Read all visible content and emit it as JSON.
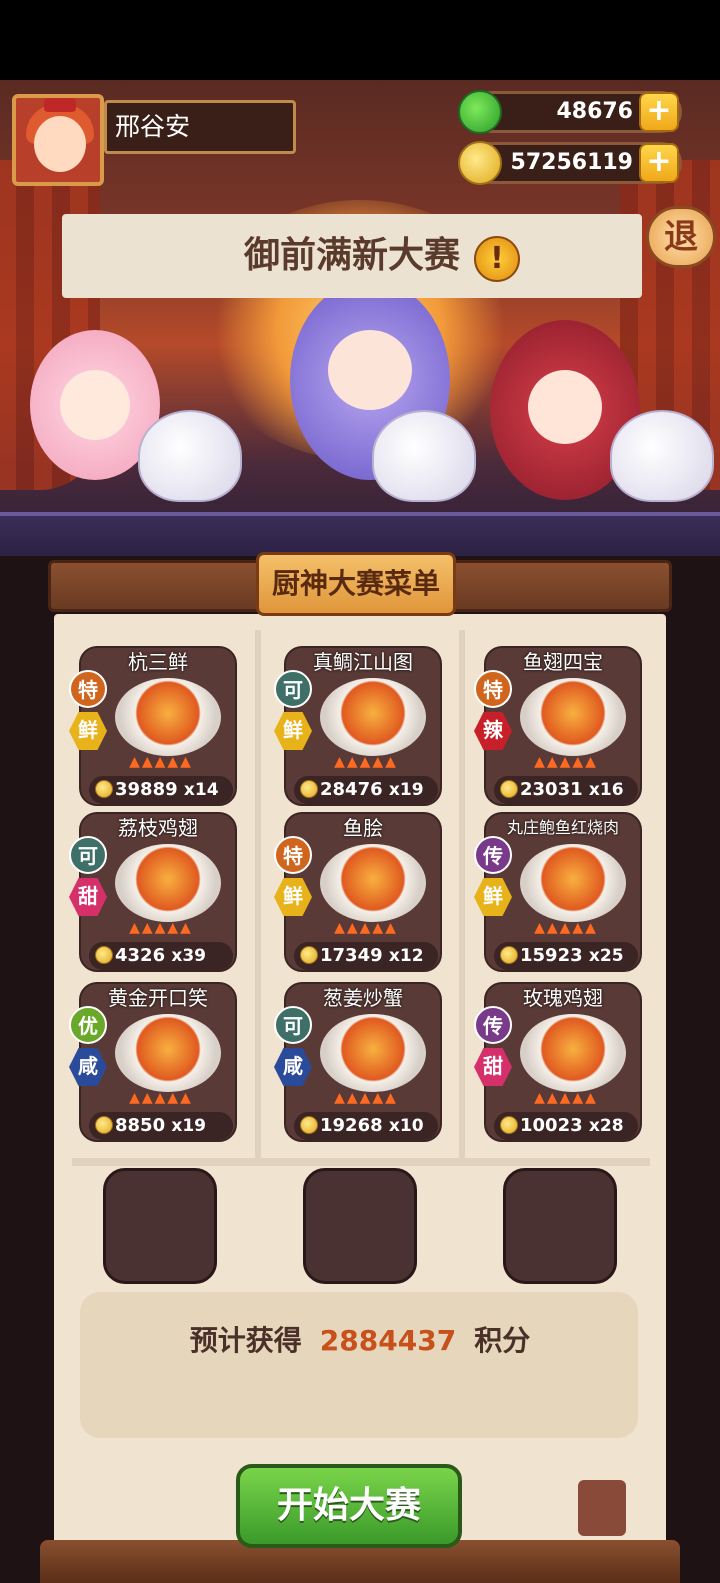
{
  "player": {
    "name": "邢谷安"
  },
  "resources": {
    "gems": "48676",
    "coins": "57256119",
    "add_label": "+"
  },
  "exit_label": "退",
  "event": {
    "title": "御前满新大赛",
    "alert": "!"
  },
  "menu": {
    "title": "厨神大赛菜单",
    "dishes": [
      {
        "name": "杭三鲜",
        "rank": "特",
        "flavor": "鲜",
        "price": "39889",
        "qty": "x14",
        "rank_color": "#d0661e",
        "flavor_color": "#e8b21a"
      },
      {
        "name": "真鲷江山图",
        "rank": "可",
        "flavor": "鲜",
        "price": "28476",
        "qty": "x19",
        "rank_color": "#3e7068",
        "flavor_color": "#e8b21a"
      },
      {
        "name": "鱼翅四宝",
        "rank": "特",
        "flavor": "辣",
        "price": "23031",
        "qty": "x16",
        "rank_color": "#d0661e",
        "flavor_color": "#c8202a"
      },
      {
        "name": "荔枝鸡翅",
        "rank": "可",
        "flavor": "甜",
        "price": "4326",
        "qty": "x39",
        "rank_color": "#3e7068",
        "flavor_color": "#d6306a"
      },
      {
        "name": "鱼脍",
        "rank": "特",
        "flavor": "鲜",
        "price": "17349",
        "qty": "x12",
        "rank_color": "#d0661e",
        "flavor_color": "#e8b21a"
      },
      {
        "name": "丸庄鲍鱼红烧肉",
        "rank": "传",
        "flavor": "鲜",
        "price": "15923",
        "qty": "x25",
        "rank_color": "#7a3a8a",
        "flavor_color": "#e8b21a"
      },
      {
        "name": "黄金开口笑",
        "rank": "优",
        "flavor": "咸",
        "price": "8850",
        "qty": "x19",
        "rank_color": "#6aa82a",
        "flavor_color": "#2a4a9a"
      },
      {
        "name": "葱姜炒蟹",
        "rank": "可",
        "flavor": "咸",
        "price": "19268",
        "qty": "x10",
        "rank_color": "#3e7068",
        "flavor_color": "#2a4a9a"
      },
      {
        "name": "玫瑰鸡翅",
        "rank": "传",
        "flavor": "甜",
        "price": "10023",
        "qty": "x28",
        "rank_color": "#7a3a8a",
        "flavor_color": "#d6306a"
      }
    ]
  },
  "estimate": {
    "prefix": "预计获得",
    "value": "2884437",
    "suffix": "积分"
  },
  "start_button": "开始大赛"
}
